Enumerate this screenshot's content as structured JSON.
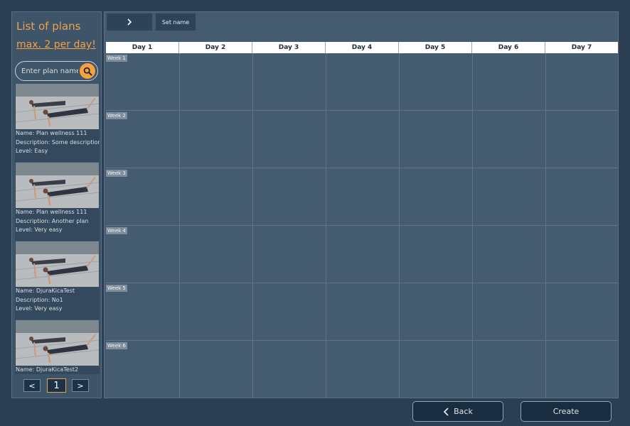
{
  "sidebar": {
    "title": "List of plans",
    "limit_link": "max. 2 per day!",
    "search_placeholder": "Enter plan name",
    "plans": [
      {
        "name": "Name: Plan wellness 111",
        "description": "Description: Some description",
        "level": "Level: Easy"
      },
      {
        "name": "Name: Plan wellness 111",
        "description": "Description: Another plan",
        "level": "Level: Very easy"
      },
      {
        "name": "Name: DjuraKicaTest",
        "description": "Description: No1",
        "level": "Level: Very easy"
      },
      {
        "name": "Name: DjuraKicaTest2",
        "description": "",
        "level": ""
      }
    ],
    "pager": {
      "prev": "<",
      "current": "1",
      "next": ">"
    }
  },
  "toolbar": {
    "set_name_label": "Set name"
  },
  "calendar": {
    "days": [
      "Day 1",
      "Day 2",
      "Day 3",
      "Day 4",
      "Day 5",
      "Day 6",
      "Day 7"
    ],
    "weeks": [
      "Week 1",
      "Week 2",
      "Week 3",
      "Week 4",
      "Week 5",
      "Week 6"
    ]
  },
  "footer": {
    "back_label": "Back",
    "create_label": "Create"
  },
  "colors": {
    "accent": "#f5a13e",
    "panel": "#455b70",
    "background": "#2c3e51"
  }
}
